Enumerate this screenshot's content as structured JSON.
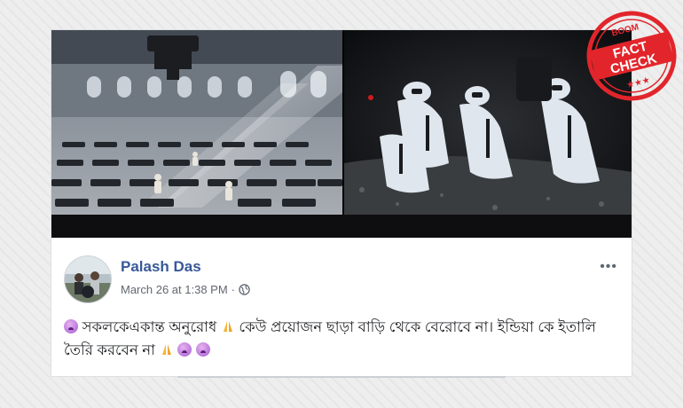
{
  "post": {
    "author": "Palash Das",
    "timestamp": "March 26 at 1:38 PM",
    "separator": "·",
    "privacy_icon": "globe-icon",
    "more_label": "•••",
    "text_part1": "সকলকেএকান্ত অনুরোধ",
    "text_part2": " কেউ প্রয়োজন ছাড়া বাড়ি থেকে বেরোবে না। ইন্ডিয়া কে ইতালি তৈরি করবেন না"
  },
  "stamp": {
    "brand": "BOOM",
    "line1": "FACT",
    "line2": "CHECK",
    "stars": "★★★",
    "color": "#e2252b"
  },
  "media": {
    "left_scene": "hall-with-covered-bodies",
    "right_scene": "workers-in-protective-suits"
  }
}
